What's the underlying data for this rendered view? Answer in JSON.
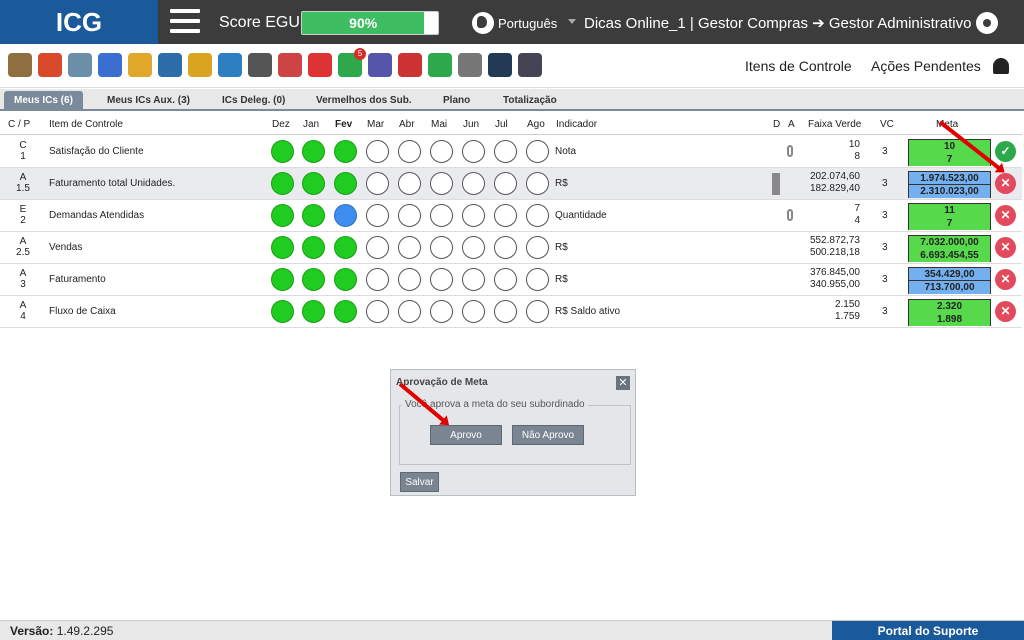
{
  "header": {
    "logo": "ICG",
    "score_label": "Score EGU:",
    "score_value": "90%",
    "score_fraction": 0.9,
    "language": "Português",
    "user": "Dicas Online_1  |  Gestor Compras ➔ Gestor Administrativo"
  },
  "toolbar": {
    "itens_controle": "Itens de Controle",
    "acoes_pendentes": "Ações Pendentes",
    "badge_count": "5",
    "icons": [
      "edit-icon",
      "target-icon",
      "clipboard-icon",
      "chart-icon",
      "pencil-icon",
      "team-icon",
      "award-icon",
      "calendar-icon",
      "stopwatch-icon",
      "org-chart-icon",
      "crosshair-icon",
      "approve-icon",
      "puzzle-icon",
      "pdf-icon",
      "off-icon",
      "presentation-icon",
      "grid-icon",
      "help-icon"
    ]
  },
  "tabs": [
    {
      "label": "Meus ICs (6)",
      "active": true
    },
    {
      "label": "Meus ICs Aux. (3)"
    },
    {
      "label": "ICs Deleg. (0)"
    },
    {
      "label": "Vermelhos dos Sub."
    },
    {
      "label": "Plano"
    },
    {
      "label": "Totalização"
    }
  ],
  "table": {
    "headers": {
      "cp": "C / P",
      "item": "Item de Controle",
      "months": [
        "Dez",
        "Jan",
        "Fev",
        "Mar",
        "Abr",
        "Mai",
        "Jun",
        "Jul",
        "Ago"
      ],
      "indicador": "Indicador",
      "d": "D",
      "a": "A",
      "faixa": "Faixa Verde",
      "vc": "VC",
      "meta": "Meta"
    },
    "rows": [
      {
        "c": "C",
        "p": "1",
        "item": "Satisfação do Cliente",
        "months": [
          "g",
          "g",
          "g",
          "e",
          "e",
          "e",
          "e",
          "e",
          "e"
        ],
        "indicador": "Nota",
        "faixa1": "10",
        "faixa2": "8",
        "vc": "3",
        "meta1": "10",
        "meta2": "7",
        "meta_color": "green",
        "status": "ok",
        "clip": true
      },
      {
        "c": "A",
        "p": "1.5",
        "item": "Faturamento total Unidades.",
        "months": [
          "g",
          "g",
          "g",
          "e",
          "e",
          "e",
          "e",
          "e",
          "e"
        ],
        "indicador": "R$",
        "faixa1": "202.074,60",
        "faixa2": "182.829,40",
        "vc": "3",
        "meta1": "1.974.523,00",
        "meta2": "2.310.023,00",
        "meta_color": "blue",
        "status": "no",
        "bar": true
      },
      {
        "c": "E",
        "p": "2",
        "item": "Demandas Atendidas",
        "months": [
          "g",
          "g",
          "b",
          "e",
          "e",
          "e",
          "e",
          "e",
          "e"
        ],
        "indicador": "Quantidade",
        "faixa1": "7",
        "faixa2": "4",
        "vc": "3",
        "meta1": "11",
        "meta2": "7",
        "meta_color": "green",
        "status": "no",
        "clip": true
      },
      {
        "c": "A",
        "p": "2.5",
        "item": "Vendas",
        "months": [
          "g",
          "g",
          "g",
          "e",
          "e",
          "e",
          "e",
          "e",
          "e"
        ],
        "indicador": "R$",
        "faixa1": "552.872,73",
        "faixa2": "500.218,18",
        "vc": "3",
        "meta1": "7.032.000,00",
        "meta2": "6.693.454,55",
        "meta_color": "green",
        "status": "no"
      },
      {
        "c": "A",
        "p": "3",
        "item": "Faturamento",
        "months": [
          "g",
          "g",
          "g",
          "e",
          "e",
          "e",
          "e",
          "e",
          "e"
        ],
        "indicador": "R$",
        "faixa1": "376.845,00",
        "faixa2": "340.955,00",
        "vc": "3",
        "meta1": "354.429,00",
        "meta2": "713.700,00",
        "meta_color": "blue",
        "status": "no"
      },
      {
        "c": "A",
        "p": "4",
        "item": "Fluxo de Caixa",
        "months": [
          "g",
          "g",
          "g",
          "e",
          "e",
          "e",
          "e",
          "e",
          "e"
        ],
        "indicador": "R$ Saldo ativo",
        "faixa1": "2.150",
        "faixa2": "1.759",
        "vc": "3",
        "meta1": "2.320",
        "meta2": "1.898",
        "meta_color": "green",
        "status": "no"
      }
    ]
  },
  "dialog": {
    "title": "Aprovação de Meta",
    "close": "✕",
    "question": "Você aprova a meta do seu subordinado",
    "approve": "Aprovo",
    "reject": "Não Aprovo",
    "save": "Salvar"
  },
  "footer": {
    "version_label": "Versão:",
    "version": "1.49.2.295",
    "portal": "Portal do Suporte"
  },
  "colors": {
    "brand": "#1a5a9b",
    "green": "#1fcc1f",
    "blue": "#3d8ef0",
    "red": "#e24b5d",
    "ok": "#2da84a"
  }
}
